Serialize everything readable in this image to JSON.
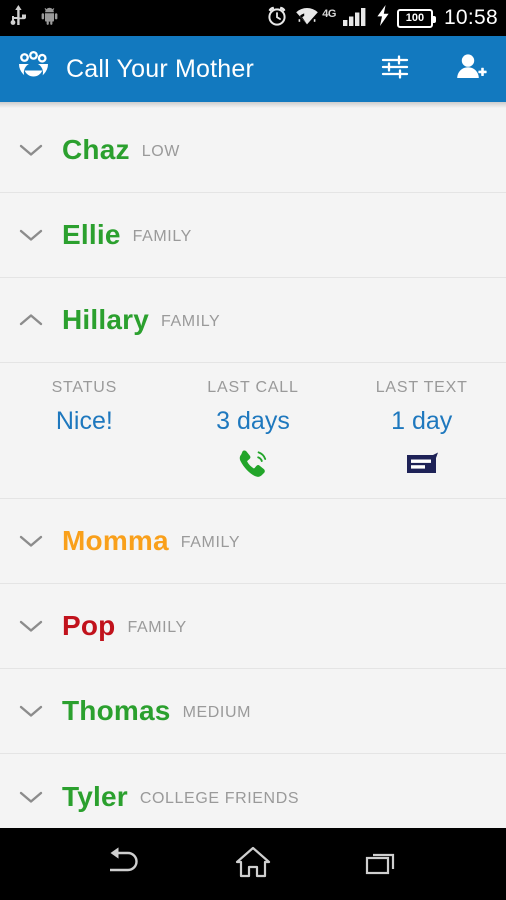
{
  "status_bar": {
    "icons": [
      "usb-icon",
      "android-icon",
      "alarm-icon",
      "wifi-icon",
      "signal-icon",
      "charging-icon"
    ],
    "network_label": "4G",
    "battery_level": "100",
    "time": "10:58"
  },
  "app_bar": {
    "logo": "app-logo-icon",
    "title": "Call Your Mother",
    "actions": [
      {
        "name": "filter-button",
        "icon": "tune-sliders-icon"
      },
      {
        "name": "add-contact-button",
        "icon": "person-add-icon"
      }
    ],
    "background_color": "#1279BF"
  },
  "colors": {
    "green": "#2BA02E",
    "orange": "#F9A01B",
    "red": "#C1121C",
    "blue": "#1E78BE",
    "tag_gray": "#9A9A9A"
  },
  "contacts": [
    {
      "name": "Chaz",
      "tag": "LOW",
      "color": "#2BA02E",
      "expanded": false,
      "chevron": "chevron-down-icon"
    },
    {
      "name": "Ellie",
      "tag": "FAMILY",
      "color": "#2BA02E",
      "expanded": false,
      "chevron": "chevron-down-icon"
    },
    {
      "name": "Hillary",
      "tag": "FAMILY",
      "color": "#2BA02E",
      "expanded": true,
      "chevron": "chevron-up-icon"
    },
    {
      "name": "Momma",
      "tag": "FAMILY",
      "color": "#F9A01B",
      "expanded": false,
      "chevron": "chevron-down-icon"
    },
    {
      "name": "Pop",
      "tag": "FAMILY",
      "color": "#C1121C",
      "expanded": false,
      "chevron": "chevron-down-icon"
    },
    {
      "name": "Thomas",
      "tag": "MEDIUM",
      "color": "#2BA02E",
      "expanded": false,
      "chevron": "chevron-down-icon"
    },
    {
      "name": "Tyler",
      "tag": "COLLEGE FRIENDS",
      "color": "#2BA02E",
      "expanded": false,
      "chevron": "chevron-down-icon"
    }
  ],
  "expanded_detail": {
    "columns": [
      {
        "label": "STATUS",
        "value": "Nice!"
      },
      {
        "label": "LAST CALL",
        "value": "3 days"
      },
      {
        "label": "LAST TEXT",
        "value": "1 day"
      }
    ],
    "actions": [
      {
        "name": "call-button",
        "icon": "phone-call-icon",
        "color": "#22A52A"
      },
      {
        "name": "text-button",
        "icon": "message-icon",
        "color": "#1E2257"
      }
    ]
  },
  "nav_bar": {
    "buttons": [
      {
        "name": "back-button",
        "icon": "back-arrow-icon"
      },
      {
        "name": "home-button",
        "icon": "home-icon"
      },
      {
        "name": "recents-button",
        "icon": "recents-icon"
      }
    ]
  }
}
